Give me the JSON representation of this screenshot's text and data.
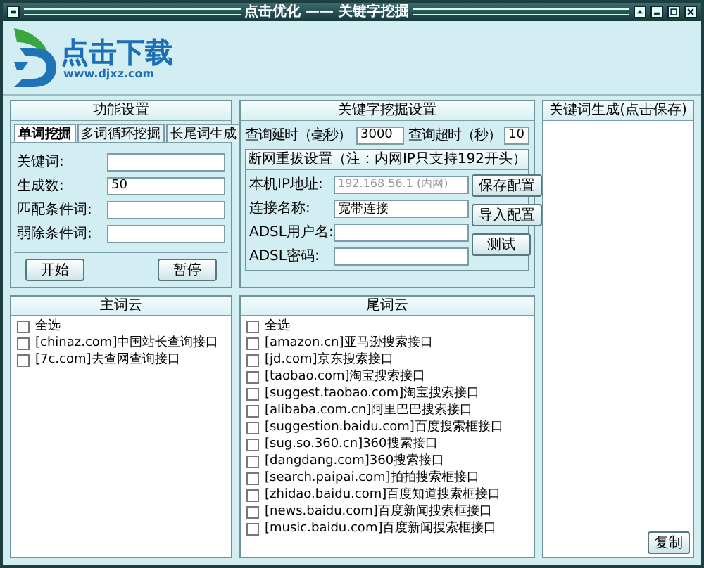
{
  "window": {
    "title": "点击优化 —— 关键字挖掘"
  },
  "logo": {
    "name": "点击下载",
    "url": "www.djxz.com"
  },
  "function_settings": {
    "title": "功能设置",
    "tabs": [
      {
        "label": "单词挖掘",
        "selected": true
      },
      {
        "label": "多词循环挖掘",
        "selected": false
      },
      {
        "label": "长尾词生成",
        "selected": false
      }
    ],
    "fields": [
      {
        "label": "关键词:"
      },
      {
        "label": "生成数:",
        "value": "50"
      },
      {
        "label": "匹配条件词:"
      },
      {
        "label": "弱除条件词:"
      }
    ],
    "buttons": [
      "开始",
      "暂停"
    ]
  },
  "mining_settings": {
    "title": "关键字挖掘设置",
    "query_delay": {
      "label": "查询延时（毫秒）",
      "value": "3000"
    },
    "query_timeout": {
      "label": "查询超时（秒）",
      "value": "10"
    },
    "redial": {
      "title": "断网重拔设置（注：内网IP只支持192开头）",
      "fields": [
        {
          "label": "本机IP地址:",
          "placeholder": "192.168.56.1 (内网)"
        },
        {
          "label": "连接名称:",
          "value": "宽带连接"
        },
        {
          "label": "ADSL用户名:"
        },
        {
          "label": "ADSL密码:"
        }
      ],
      "buttons": [
        "保存配置",
        "导入配置",
        "测试"
      ]
    }
  },
  "main_cloud": {
    "title": "主词云",
    "items": [
      {
        "label": "全选",
        "checked": false
      },
      {
        "label": "[chinaz.com]中国站长查询接口",
        "checked": false
      },
      {
        "label": "[7c.com]去查网查询接口",
        "checked": false
      }
    ]
  },
  "tail_cloud": {
    "title": "尾词云",
    "items": [
      {
        "label": "全选",
        "checked": false
      },
      {
        "label": "[amazon.cn]亚马逊搜索接口",
        "checked": false
      },
      {
        "label": "[jd.com]京东搜索接口",
        "checked": false
      },
      {
        "label": "[taobao.com]淘宝搜索接口",
        "checked": false
      },
      {
        "label": "[suggest.taobao.com]淘宝搜索接口",
        "checked": false
      },
      {
        "label": "[alibaba.com.cn]阿里巴巴搜索接口",
        "checked": false
      },
      {
        "label": "[suggestion.baidu.com]百度搜索框接口",
        "checked": false
      },
      {
        "label": "[sug.so.360.cn]360搜索接口",
        "checked": false
      },
      {
        "label": "[dangdang.com]360搜索接口",
        "checked": false
      },
      {
        "label": "[search.paipai.com]拍拍搜索框接口",
        "checked": false
      },
      {
        "label": "[zhidao.baidu.com]百度知道搜索框接口",
        "checked": false
      },
      {
        "label": "[news.baidu.com]百度新闻搜索框接口",
        "checked": false
      },
      {
        "label": "[music.baidu.com]百度新闻搜索框接口",
        "checked": false
      }
    ]
  },
  "output": {
    "title": "关键词生成(点击保存)",
    "buttons": [
      "复制"
    ]
  }
}
